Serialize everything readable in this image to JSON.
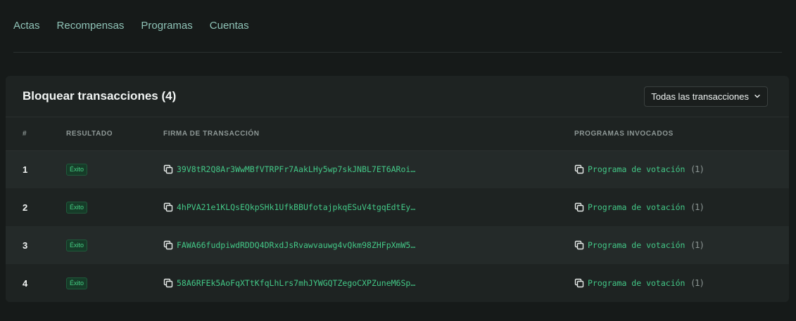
{
  "tabs": [
    "Actas",
    "Recompensas",
    "Programas",
    "Cuentas"
  ],
  "card": {
    "title": "Bloquear transacciones (4)",
    "filter_label": "Todas las transacciones"
  },
  "table": {
    "headers": [
      "#",
      "RESULTADO",
      "FIRMA DE TRANSACCIÓN",
      "PROGRAMAS INVOCADOS"
    ],
    "rows": [
      {
        "index": "1",
        "result": "Éxito",
        "signature": "39V8tR2Q8Ar3WwMBfVTRPFr7AakLHy5wp7skJNBL7ET6ARoi…",
        "program": "Programa de votación",
        "count": "(1)"
      },
      {
        "index": "2",
        "result": "Éxito",
        "signature": "4hPVA21e1KLQsEQkpSHk1UfkBBUfotajpkqESuV4tgqEdtEy…",
        "program": "Programa de votación",
        "count": "(1)"
      },
      {
        "index": "3",
        "result": "Éxito",
        "signature": "FAWA66fudpiwdRDDQ4DRxdJsRvawvauwg4vQkm98ZHFpXmW5…",
        "program": "Programa de votación",
        "count": "(1)"
      },
      {
        "index": "4",
        "result": "Éxito",
        "signature": "58A6RFEk5AoFqXTtKfqLhLrs7mhJYWGQTZegoCXPZuneM6Sp…",
        "program": "Programa de votación",
        "count": "(1)"
      }
    ]
  },
  "icons": {
    "copy": "copy-icon",
    "chevron": "chevron-down-icon"
  },
  "colors": {
    "accent": "#43c887",
    "success_badge": "#45d184",
    "background": "#161a19",
    "card": "#1e2322"
  }
}
